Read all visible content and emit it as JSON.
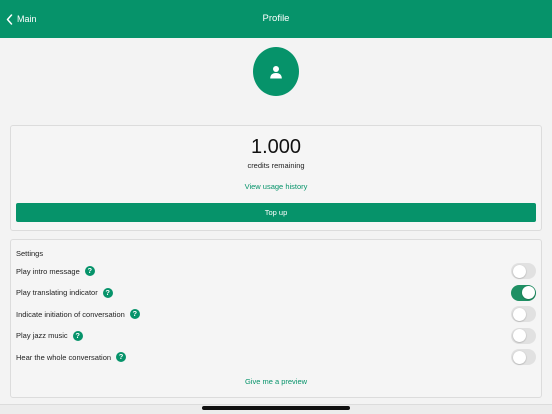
{
  "nav": {
    "back_label": "Main",
    "title": "Profile"
  },
  "avatar": {
    "icon": "user-icon"
  },
  "credits": {
    "value": "1.000",
    "label": "credits remaining",
    "usage_link": "View usage history",
    "topup_label": "Top up"
  },
  "settings": {
    "title": "Settings",
    "items": [
      {
        "label": "Play intro message",
        "enabled": false
      },
      {
        "label": "Play translating indicator",
        "enabled": true
      },
      {
        "label": "Indicate initiation of conversation",
        "enabled": false
      },
      {
        "label": "Play jazz music",
        "enabled": false
      },
      {
        "label": "Hear the whole conversation",
        "enabled": false
      }
    ],
    "preview_link": "Give me a preview"
  },
  "colors": {
    "accent": "#06936a",
    "toggle_on": "#1e8f63",
    "toggle_off": "#e1e1e1",
    "background": "#f3f3f3"
  }
}
